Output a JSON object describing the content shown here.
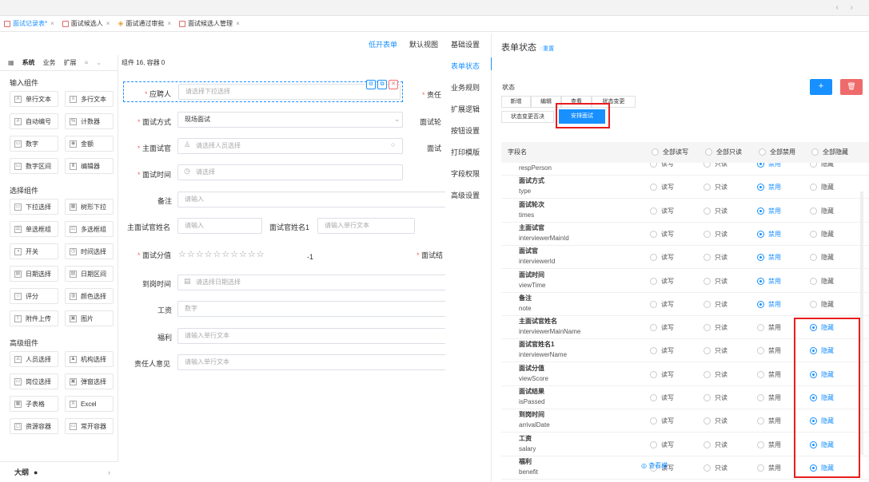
{
  "nav_arrows": "‹  ›",
  "tabs": [
    {
      "label": "面试记录表*",
      "icon": "form-icon",
      "active": true
    },
    {
      "label": "面试候选人",
      "icon": "form-icon",
      "active": false
    },
    {
      "label": "面试通过审批",
      "icon": "diamond-icon",
      "active": false
    },
    {
      "label": "面试候选人管理",
      "icon": "form-icon",
      "active": false
    }
  ],
  "palette": {
    "tabs": [
      "系统",
      "业务",
      "扩展"
    ],
    "sections": [
      {
        "title": "输入组件",
        "items": [
          "单行文本",
          "多行文本",
          "自动编号",
          "计数器",
          "数字",
          "金额",
          "数字区间",
          "编辑器"
        ]
      },
      {
        "title": "选择组件",
        "items": [
          "下拉选择",
          "树形下拉",
          "单选框组",
          "多选框组",
          "开关",
          "时间选择",
          "日期选择",
          "日期区间",
          "评分",
          "颜色选择",
          "附件上传",
          "图片"
        ]
      },
      {
        "title": "高级组件",
        "items": [
          "人员选择",
          "机构选择",
          "岗位选择",
          "弹窗选择",
          "子表格",
          "Excel",
          "资源容器",
          "常开容器"
        ]
      }
    ],
    "outline_label": "大纲",
    "outline_chevron": "›"
  },
  "canvas": {
    "view_links": [
      "低开表单",
      "默认视图"
    ],
    "component_count": "组件 16, 容器 0",
    "fields": {
      "applicant": {
        "label": "应聘人",
        "placeholder": "请选择下拉选择",
        "required": true
      },
      "interview_mode": {
        "label": "面试方式",
        "value": "现场面试",
        "required": true
      },
      "main_interviewer": {
        "label": "主面试官",
        "placeholder": "请选择人员选择",
        "required": true
      },
      "interview_time": {
        "label": "面试时间",
        "placeholder": "请选择",
        "required": true
      },
      "remark": {
        "label": "备注",
        "placeholder": "请输入"
      },
      "main_interviewer_name": {
        "label": "主面试官姓名",
        "placeholder": "请输入"
      },
      "interviewer_name1": {
        "label": "面试官姓名1",
        "placeholder": "请输入单行文本"
      },
      "score": {
        "label": "面试分值",
        "value": "-1",
        "required": true
      },
      "arrival_time": {
        "label": "到岗时间",
        "placeholder": "请选择日期选择"
      },
      "salary": {
        "label": "工资",
        "placeholder": "数字"
      },
      "benefit": {
        "label": "福利",
        "placeholder": "请输入单行文本"
      },
      "responsible_opinion": {
        "label": "责任人意见",
        "placeholder": "请输入单行文本"
      }
    },
    "cut_labels": [
      "责任",
      "面试轮",
      "面试",
      "面试结"
    ]
  },
  "settings_menu": [
    "基础设置",
    "表单状态",
    "业务规则",
    "扩展逻辑",
    "按钮设置",
    "打印模版",
    "字段权限",
    "高级设置"
  ],
  "settings_active": "表单状态",
  "right_panel": {
    "title": "表单状态",
    "reset_label": "◌重置",
    "state_label": "状态",
    "state_buttons_row1": [
      "新增",
      "编辑",
      "查看",
      "状态变更"
    ],
    "state_buttons_row2": [
      "状态变更否决",
      "安排面试"
    ],
    "add_label": "+",
    "delete_label": "🗑",
    "table_header": {
      "field_col": "字段名",
      "all_rw": "全部读写",
      "all_ro": "全部只读",
      "all_disabled": "全部禁用",
      "all_hidden": "全部隐藏"
    },
    "option_labels": [
      "读写",
      "只读",
      "禁用",
      "隐藏"
    ],
    "rows": [
      {
        "name": "",
        "key": "respPerson",
        "selected": 2
      },
      {
        "name": "面试方式",
        "key": "type",
        "selected": 2
      },
      {
        "name": "面试轮次",
        "key": "times",
        "selected": 2
      },
      {
        "name": "主面试官",
        "key": "interviewerMainId",
        "selected": 2
      },
      {
        "name": "面试官",
        "key": "interviewerId",
        "selected": 2
      },
      {
        "name": "面试时间",
        "key": "viewTime",
        "selected": 2
      },
      {
        "name": "备注",
        "key": "note",
        "selected": 2
      },
      {
        "name": "主面试官姓名",
        "key": "interviewerMainName",
        "selected": 3
      },
      {
        "name": "面试官姓名1",
        "key": "interviewerName",
        "selected": 3
      },
      {
        "name": "面试分值",
        "key": "viewScore",
        "selected": 3
      },
      {
        "name": "面试结果",
        "key": "isPassed",
        "selected": 3
      },
      {
        "name": "到岗时间",
        "key": "arrivalDate",
        "selected": 3
      },
      {
        "name": "工资",
        "key": "salary",
        "selected": 3
      },
      {
        "name": "福利",
        "key": "benefit",
        "selected": 3
      }
    ],
    "peek_label": "◎ 查看模"
  },
  "colors": {
    "accent": "#1890ff",
    "danger": "#e81d1d",
    "required": "#f56c6c"
  }
}
